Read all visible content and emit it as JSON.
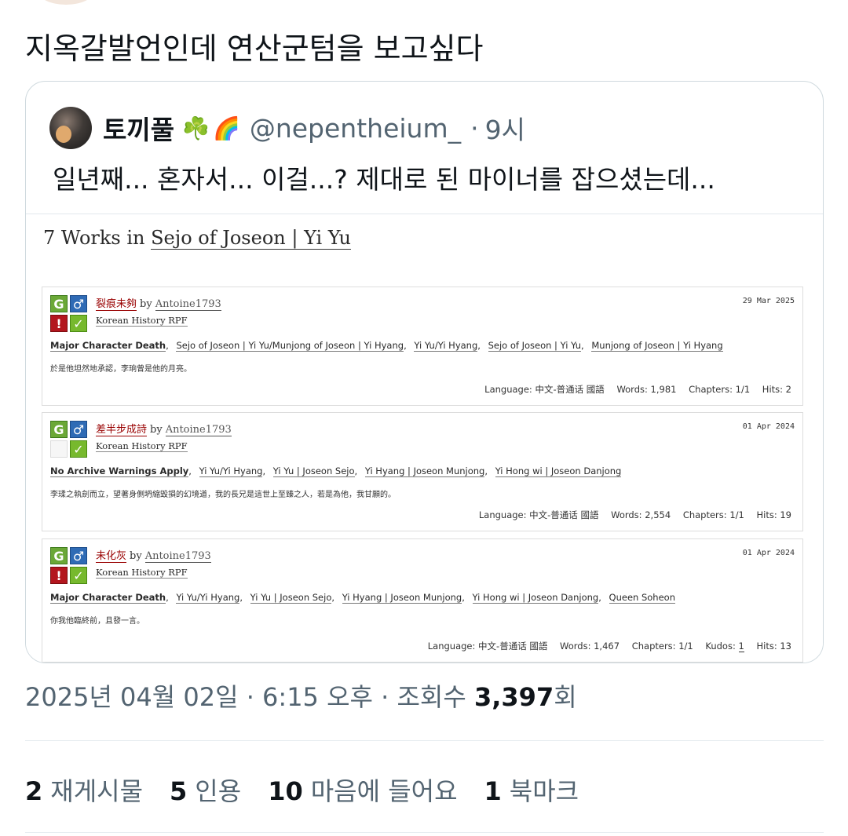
{
  "tweet": {
    "text": "지옥갈발언인데 연산군텀을 보고싶다",
    "timestamp": "2025년 04월 02일 · 6:15 오후 · 조회수 ",
    "views": "3,397",
    "views_suffix": "회"
  },
  "quote": {
    "name": "토끼풀",
    "emoji1": "☘️",
    "emoji2": "🌈",
    "handle": "@nepentheium_",
    "dot": "·",
    "time": "9시",
    "text": "일년째... 혼자서... 이걸...? 제대로 된 마이너를 잡으셨는데...",
    "screenshot": {
      "title_prefix": "7 Works in ",
      "title_link": "Sejo of Joseon | Yi Yu",
      "works": [
        {
          "title": "裂痕未夠",
          "by": "by",
          "author": "Antoine1793",
          "date": "29 Mar 2025",
          "fandom": "Korean History RPF",
          "icon_rating": "G",
          "icon_category": "♂",
          "icon_warning": "!",
          "icon_complete": "✓",
          "tags": [
            "Major Character Death",
            "Sejo of Joseon | Yi Yu/Munjong of Joseon | Yi Hyang",
            "Yi Yu/Yi Hyang",
            "Sejo of Joseon | Yi Yu",
            "Munjong of Joseon | Yi Hyang"
          ],
          "summary": "於是他坦然地承認，李珦曾是他的月亮。",
          "stats": {
            "language_label": "Language:",
            "language": "中文-普通话 國語",
            "words_label": "Words:",
            "words": "1,981",
            "chapters_label": "Chapters:",
            "chapters": "1/1",
            "hits_label": "Hits:",
            "hits": "2"
          }
        },
        {
          "title": "差半步成詩",
          "by": "by",
          "author": "Antoine1793",
          "date": "01 Apr 2024",
          "fandom": "Korean History RPF",
          "icon_rating": "G",
          "icon_category": "♂",
          "icon_warning": "",
          "icon_complete": "✓",
          "tags": [
            "No Archive Warnings Apply",
            "Yi Yu/Yi Hyang",
            "Yi Yu | Joseon Sejo",
            "Yi Hyang | Joseon Munjong",
            "Yi Hong wi | Joseon Danjong"
          ],
          "summary": "李瑈之執劍而立，望著身側坍縮毀損的幻境道，我的長兄是這世上至臻之人，若是為他，我甘願的。",
          "stats": {
            "language_label": "Language:",
            "language": "中文-普通话 國語",
            "words_label": "Words:",
            "words": "2,554",
            "chapters_label": "Chapters:",
            "chapters": "1/1",
            "hits_label": "Hits:",
            "hits": "19"
          }
        },
        {
          "title": "未化灰",
          "by": "by",
          "author": "Antoine1793",
          "date": "01 Apr 2024",
          "fandom": "Korean History RPF",
          "icon_rating": "G",
          "icon_category": "♂",
          "icon_warning": "!",
          "icon_complete": "✓",
          "tags": [
            "Major Character Death",
            "Yi Yu/Yi Hyang",
            "Yi Yu | Joseon Sejo",
            "Yi Hyang | Joseon Munjong",
            "Yi Hong wi | Joseon Danjong",
            "Queen Soheon"
          ],
          "summary": "你我他臨終前，且發一言。",
          "stats": {
            "language_label": "Language:",
            "language": "中文-普通话 國語",
            "words_label": "Words:",
            "words": "1,467",
            "chapters_label": "Chapters:",
            "chapters": "1/1",
            "kudos_label": "Kudos:",
            "kudos": "1",
            "hits_label": "Hits:",
            "hits": "13"
          }
        }
      ]
    }
  },
  "engagement": {
    "retweets_num": "2",
    "retweets_label": "재게시물",
    "quotes_num": "5",
    "quotes_label": "인용",
    "likes_num": "10",
    "likes_label": "마음에 들어요",
    "bookmarks_num": "1",
    "bookmarks_label": "북마크"
  }
}
